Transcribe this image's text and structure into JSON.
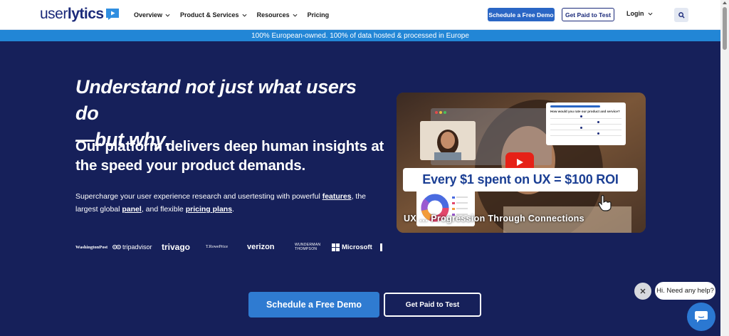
{
  "header": {
    "logo": {
      "text_light": "user",
      "text_bold": "lytics"
    },
    "nav": [
      {
        "label": "Overview",
        "has_dropdown": true
      },
      {
        "label": "Product & Services",
        "has_dropdown": true
      },
      {
        "label": "Resources",
        "has_dropdown": true
      },
      {
        "label": "Pricing",
        "has_dropdown": false
      }
    ],
    "demo_button": "Schedule a Free Demo",
    "paid_button": "Get Paid to Test",
    "login": "Login",
    "search_icon": "search-icon"
  },
  "banner": {
    "text": "100% European-owned. 100% of data hosted & processed in Europe"
  },
  "hero": {
    "heading_line1": "Understand not just what users do",
    "heading_line2": "—but why.",
    "subheading_line1": "Our platform delivers deep human insights at",
    "subheading_line2": "the speed your product demands.",
    "para_prefix": "Supercharge your user experience research and usertesting with powerful ",
    "link_features": "features",
    "para_mid1": ", the largest global ",
    "link_panel": "panel",
    "para_mid2": ", and flexible ",
    "link_pricing": "pricing plans",
    "para_suffix": "."
  },
  "logos": {
    "washington_post": "WashingtonPost",
    "tripadvisor": "tripadvisor",
    "trivago": "trivago",
    "trowe_line1": "T.RowePrice",
    "verizon": "verizon",
    "wunderman_line1": "WUNDERMAN",
    "wunderman_line2": "THOMPSON",
    "microsoft": "Microsoft"
  },
  "video": {
    "survey_question": "How would you rate our product and service?",
    "banner": "Every $1 spent on UX = $100 ROI",
    "caption": "UX … Progression Through Connections"
  },
  "cta": {
    "primary": "Schedule a Free Demo",
    "secondary": "Get Paid to Test"
  },
  "chat": {
    "greeting": "Hi. Need any help?"
  },
  "colors": {
    "hero_bg": "#16205a",
    "banner_bg": "#2286d6",
    "primary_blue": "#2f7bd1",
    "brand_navy": "#1b2a7a"
  }
}
